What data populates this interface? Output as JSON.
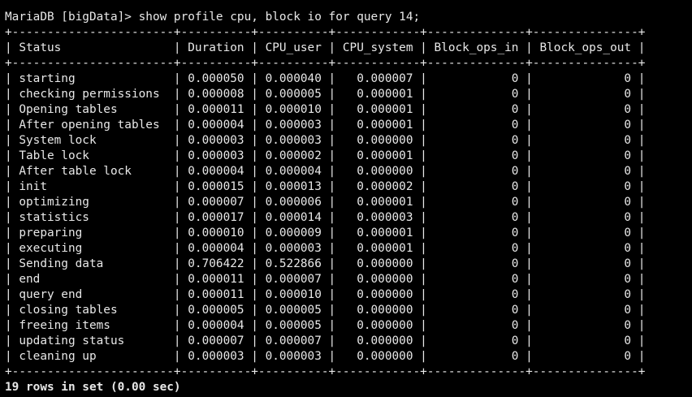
{
  "terminal": {
    "prompt_line": "MariaDB [bigData]> show profile cpu, block io for query 14;",
    "border_line": "+-----------------------+----------+----------+------------+--------------+---------------+",
    "header_line": "| Status                | Duration | CPU_user | CPU_system | Block_ops_in | Block_ops_out |",
    "columns": [
      "Status",
      "Duration",
      "CPU_user",
      "CPU_system",
      "Block_ops_in",
      "Block_ops_out"
    ],
    "rows": [
      {
        "status": "starting",
        "duration": "0.000050",
        "cpu_user": "0.000040",
        "cpu_system": "0.000007",
        "block_ops_in": "0",
        "block_ops_out": "0",
        "text": "| starting              | 0.000050 | 0.000040 |   0.000007 |            0 |             0 |"
      },
      {
        "status": "checking permissions",
        "duration": "0.000008",
        "cpu_user": "0.000005",
        "cpu_system": "0.000001",
        "block_ops_in": "0",
        "block_ops_out": "0",
        "text": "| checking permissions  | 0.000008 | 0.000005 |   0.000001 |            0 |             0 |"
      },
      {
        "status": "Opening tables",
        "duration": "0.000011",
        "cpu_user": "0.000010",
        "cpu_system": "0.000001",
        "block_ops_in": "0",
        "block_ops_out": "0",
        "text": "| Opening tables        | 0.000011 | 0.000010 |   0.000001 |            0 |             0 |"
      },
      {
        "status": "After opening tables",
        "duration": "0.000004",
        "cpu_user": "0.000003",
        "cpu_system": "0.000001",
        "block_ops_in": "0",
        "block_ops_out": "0",
        "text": "| After opening tables  | 0.000004 | 0.000003 |   0.000001 |            0 |             0 |"
      },
      {
        "status": "System lock",
        "duration": "0.000003",
        "cpu_user": "0.000003",
        "cpu_system": "0.000000",
        "block_ops_in": "0",
        "block_ops_out": "0",
        "text": "| System lock           | 0.000003 | 0.000003 |   0.000000 |            0 |             0 |"
      },
      {
        "status": "Table lock",
        "duration": "0.000003",
        "cpu_user": "0.000002",
        "cpu_system": "0.000001",
        "block_ops_in": "0",
        "block_ops_out": "0",
        "text": "| Table lock            | 0.000003 | 0.000002 |   0.000001 |            0 |             0 |"
      },
      {
        "status": "After table lock",
        "duration": "0.000004",
        "cpu_user": "0.000004",
        "cpu_system": "0.000000",
        "block_ops_in": "0",
        "block_ops_out": "0",
        "text": "| After table lock      | 0.000004 | 0.000004 |   0.000000 |            0 |             0 |"
      },
      {
        "status": "init",
        "duration": "0.000015",
        "cpu_user": "0.000013",
        "cpu_system": "0.000002",
        "block_ops_in": "0",
        "block_ops_out": "0",
        "text": "| init                  | 0.000015 | 0.000013 |   0.000002 |            0 |             0 |"
      },
      {
        "status": "optimizing",
        "duration": "0.000007",
        "cpu_user": "0.000006",
        "cpu_system": "0.000001",
        "block_ops_in": "0",
        "block_ops_out": "0",
        "text": "| optimizing            | 0.000007 | 0.000006 |   0.000001 |            0 |             0 |"
      },
      {
        "status": "statistics",
        "duration": "0.000017",
        "cpu_user": "0.000014",
        "cpu_system": "0.000003",
        "block_ops_in": "0",
        "block_ops_out": "0",
        "text": "| statistics            | 0.000017 | 0.000014 |   0.000003 |            0 |             0 |"
      },
      {
        "status": "preparing",
        "duration": "0.000010",
        "cpu_user": "0.000009",
        "cpu_system": "0.000001",
        "block_ops_in": "0",
        "block_ops_out": "0",
        "text": "| preparing             | 0.000010 | 0.000009 |   0.000001 |            0 |             0 |"
      },
      {
        "status": "executing",
        "duration": "0.000004",
        "cpu_user": "0.000003",
        "cpu_system": "0.000001",
        "block_ops_in": "0",
        "block_ops_out": "0",
        "text": "| executing             | 0.000004 | 0.000003 |   0.000001 |            0 |             0 |"
      },
      {
        "status": "Sending data",
        "duration": "0.706422",
        "cpu_user": "0.522866",
        "cpu_system": "0.000000",
        "block_ops_in": "0",
        "block_ops_out": "0",
        "text": "| Sending data          | 0.706422 | 0.522866 |   0.000000 |            0 |             0 |"
      },
      {
        "status": "end",
        "duration": "0.000011",
        "cpu_user": "0.000007",
        "cpu_system": "0.000000",
        "block_ops_in": "0",
        "block_ops_out": "0",
        "text": "| end                   | 0.000011 | 0.000007 |   0.000000 |            0 |             0 |"
      },
      {
        "status": "query end",
        "duration": "0.000011",
        "cpu_user": "0.000010",
        "cpu_system": "0.000000",
        "block_ops_in": "0",
        "block_ops_out": "0",
        "text": "| query end             | 0.000011 | 0.000010 |   0.000000 |            0 |             0 |"
      },
      {
        "status": "closing tables",
        "duration": "0.000005",
        "cpu_user": "0.000005",
        "cpu_system": "0.000000",
        "block_ops_in": "0",
        "block_ops_out": "0",
        "text": "| closing tables        | 0.000005 | 0.000005 |   0.000000 |            0 |             0 |"
      },
      {
        "status": "freeing items",
        "duration": "0.000004",
        "cpu_user": "0.000005",
        "cpu_system": "0.000000",
        "block_ops_in": "0",
        "block_ops_out": "0",
        "text": "| freeing items         | 0.000004 | 0.000005 |   0.000000 |            0 |             0 |"
      },
      {
        "status": "updating status",
        "duration": "0.000007",
        "cpu_user": "0.000007",
        "cpu_system": "0.000000",
        "block_ops_in": "0",
        "block_ops_out": "0",
        "text": "| updating status       | 0.000007 | 0.000007 |   0.000000 |            0 |             0 |"
      },
      {
        "status": "cleaning up",
        "duration": "0.000003",
        "cpu_user": "0.000003",
        "cpu_system": "0.000000",
        "block_ops_in": "0",
        "block_ops_out": "0",
        "text": "| cleaning up           | 0.000003 | 0.000003 |   0.000000 |            0 |             0 |"
      }
    ],
    "footer": "19 rows in set (0.00 sec)",
    "colors": {
      "background": "#000000",
      "foreground": "#e8e8e8"
    }
  }
}
